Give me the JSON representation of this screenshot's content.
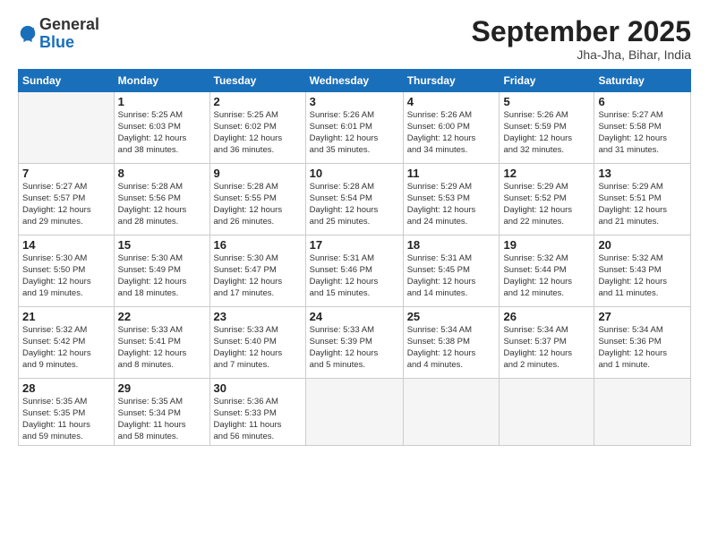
{
  "logo": {
    "general": "General",
    "blue": "Blue"
  },
  "header": {
    "month": "September 2025",
    "location": "Jha-Jha, Bihar, India"
  },
  "days_of_week": [
    "Sunday",
    "Monday",
    "Tuesday",
    "Wednesday",
    "Thursday",
    "Friday",
    "Saturday"
  ],
  "weeks": [
    [
      {
        "num": "",
        "info": ""
      },
      {
        "num": "1",
        "info": "Sunrise: 5:25 AM\nSunset: 6:03 PM\nDaylight: 12 hours\nand 38 minutes."
      },
      {
        "num": "2",
        "info": "Sunrise: 5:25 AM\nSunset: 6:02 PM\nDaylight: 12 hours\nand 36 minutes."
      },
      {
        "num": "3",
        "info": "Sunrise: 5:26 AM\nSunset: 6:01 PM\nDaylight: 12 hours\nand 35 minutes."
      },
      {
        "num": "4",
        "info": "Sunrise: 5:26 AM\nSunset: 6:00 PM\nDaylight: 12 hours\nand 34 minutes."
      },
      {
        "num": "5",
        "info": "Sunrise: 5:26 AM\nSunset: 5:59 PM\nDaylight: 12 hours\nand 32 minutes."
      },
      {
        "num": "6",
        "info": "Sunrise: 5:27 AM\nSunset: 5:58 PM\nDaylight: 12 hours\nand 31 minutes."
      }
    ],
    [
      {
        "num": "7",
        "info": "Sunrise: 5:27 AM\nSunset: 5:57 PM\nDaylight: 12 hours\nand 29 minutes."
      },
      {
        "num": "8",
        "info": "Sunrise: 5:28 AM\nSunset: 5:56 PM\nDaylight: 12 hours\nand 28 minutes."
      },
      {
        "num": "9",
        "info": "Sunrise: 5:28 AM\nSunset: 5:55 PM\nDaylight: 12 hours\nand 26 minutes."
      },
      {
        "num": "10",
        "info": "Sunrise: 5:28 AM\nSunset: 5:54 PM\nDaylight: 12 hours\nand 25 minutes."
      },
      {
        "num": "11",
        "info": "Sunrise: 5:29 AM\nSunset: 5:53 PM\nDaylight: 12 hours\nand 24 minutes."
      },
      {
        "num": "12",
        "info": "Sunrise: 5:29 AM\nSunset: 5:52 PM\nDaylight: 12 hours\nand 22 minutes."
      },
      {
        "num": "13",
        "info": "Sunrise: 5:29 AM\nSunset: 5:51 PM\nDaylight: 12 hours\nand 21 minutes."
      }
    ],
    [
      {
        "num": "14",
        "info": "Sunrise: 5:30 AM\nSunset: 5:50 PM\nDaylight: 12 hours\nand 19 minutes."
      },
      {
        "num": "15",
        "info": "Sunrise: 5:30 AM\nSunset: 5:49 PM\nDaylight: 12 hours\nand 18 minutes."
      },
      {
        "num": "16",
        "info": "Sunrise: 5:30 AM\nSunset: 5:47 PM\nDaylight: 12 hours\nand 17 minutes."
      },
      {
        "num": "17",
        "info": "Sunrise: 5:31 AM\nSunset: 5:46 PM\nDaylight: 12 hours\nand 15 minutes."
      },
      {
        "num": "18",
        "info": "Sunrise: 5:31 AM\nSunset: 5:45 PM\nDaylight: 12 hours\nand 14 minutes."
      },
      {
        "num": "19",
        "info": "Sunrise: 5:32 AM\nSunset: 5:44 PM\nDaylight: 12 hours\nand 12 minutes."
      },
      {
        "num": "20",
        "info": "Sunrise: 5:32 AM\nSunset: 5:43 PM\nDaylight: 12 hours\nand 11 minutes."
      }
    ],
    [
      {
        "num": "21",
        "info": "Sunrise: 5:32 AM\nSunset: 5:42 PM\nDaylight: 12 hours\nand 9 minutes."
      },
      {
        "num": "22",
        "info": "Sunrise: 5:33 AM\nSunset: 5:41 PM\nDaylight: 12 hours\nand 8 minutes."
      },
      {
        "num": "23",
        "info": "Sunrise: 5:33 AM\nSunset: 5:40 PM\nDaylight: 12 hours\nand 7 minutes."
      },
      {
        "num": "24",
        "info": "Sunrise: 5:33 AM\nSunset: 5:39 PM\nDaylight: 12 hours\nand 5 minutes."
      },
      {
        "num": "25",
        "info": "Sunrise: 5:34 AM\nSunset: 5:38 PM\nDaylight: 12 hours\nand 4 minutes."
      },
      {
        "num": "26",
        "info": "Sunrise: 5:34 AM\nSunset: 5:37 PM\nDaylight: 12 hours\nand 2 minutes."
      },
      {
        "num": "27",
        "info": "Sunrise: 5:34 AM\nSunset: 5:36 PM\nDaylight: 12 hours\nand 1 minute."
      }
    ],
    [
      {
        "num": "28",
        "info": "Sunrise: 5:35 AM\nSunset: 5:35 PM\nDaylight: 11 hours\nand 59 minutes."
      },
      {
        "num": "29",
        "info": "Sunrise: 5:35 AM\nSunset: 5:34 PM\nDaylight: 11 hours\nand 58 minutes."
      },
      {
        "num": "30",
        "info": "Sunrise: 5:36 AM\nSunset: 5:33 PM\nDaylight: 11 hours\nand 56 minutes."
      },
      {
        "num": "",
        "info": ""
      },
      {
        "num": "",
        "info": ""
      },
      {
        "num": "",
        "info": ""
      },
      {
        "num": "",
        "info": ""
      }
    ]
  ]
}
